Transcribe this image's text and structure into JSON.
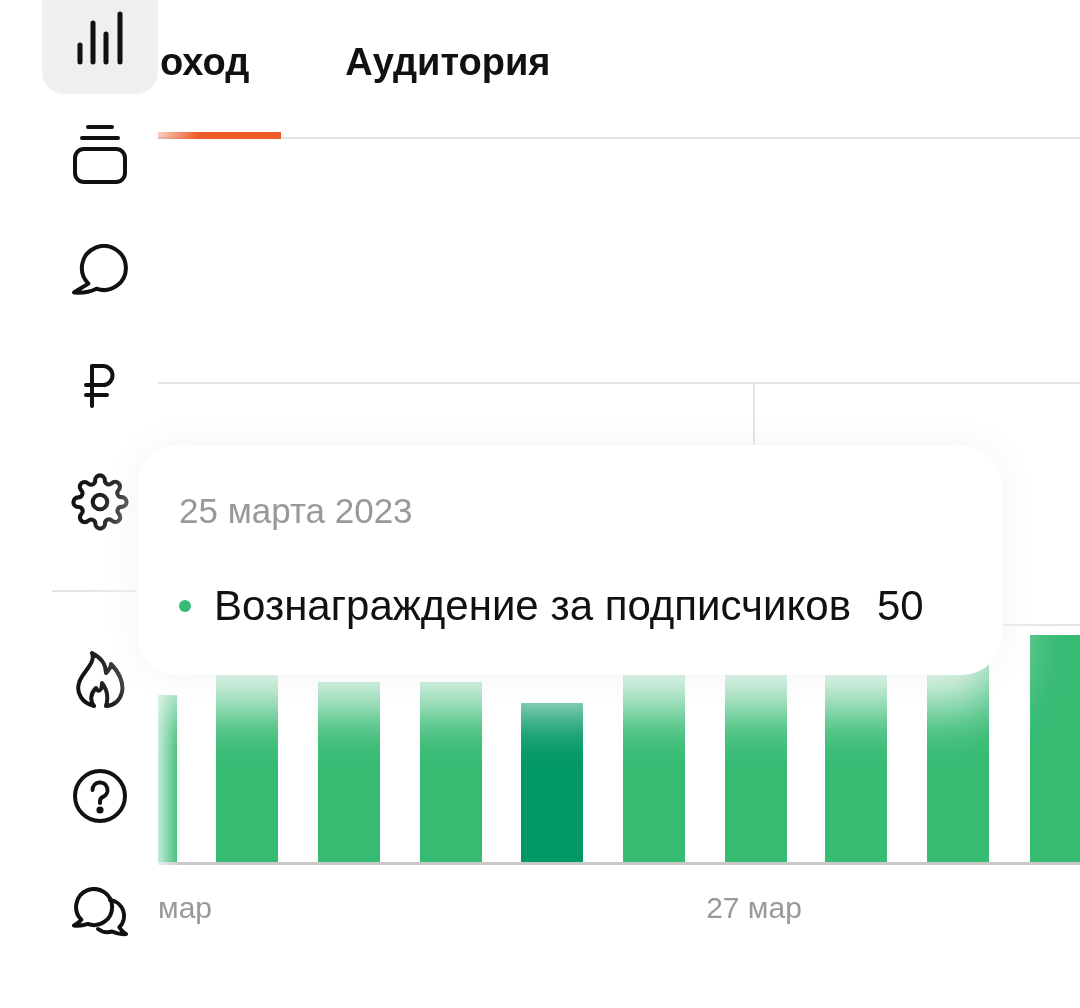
{
  "sidebar": {
    "groups": [
      {
        "items": [
          {
            "selected": true
          },
          {
            "selected": false
          },
          {
            "selected": false
          },
          {
            "selected": false
          },
          {
            "selected": false
          }
        ]
      },
      {
        "items": [
          {
            "selected": false
          },
          {
            "selected": false
          },
          {
            "selected": false
          }
        ]
      }
    ]
  },
  "tabs": [
    {
      "label": "оход",
      "selected": true
    },
    {
      "label": "Аудитория",
      "selected": false
    }
  ],
  "chart": {
    "bars": [
      {
        "selected": false
      },
      {
        "selected": false
      },
      {
        "selected": false
      },
      {
        "selected": false
      },
      {
        "selected": true
      },
      {
        "selected": false
      },
      {
        "selected": false
      },
      {
        "selected": false
      },
      {
        "selected": false
      },
      {
        "selected": false
      }
    ],
    "x_labels": [
      "мар",
      "27 мар"
    ]
  },
  "tooltip": {
    "date": "25 марта 2023",
    "series": [
      {
        "name": "Вознаграждение за подписчиков",
        "value": "50",
        "color": "#36bb73"
      }
    ]
  }
}
